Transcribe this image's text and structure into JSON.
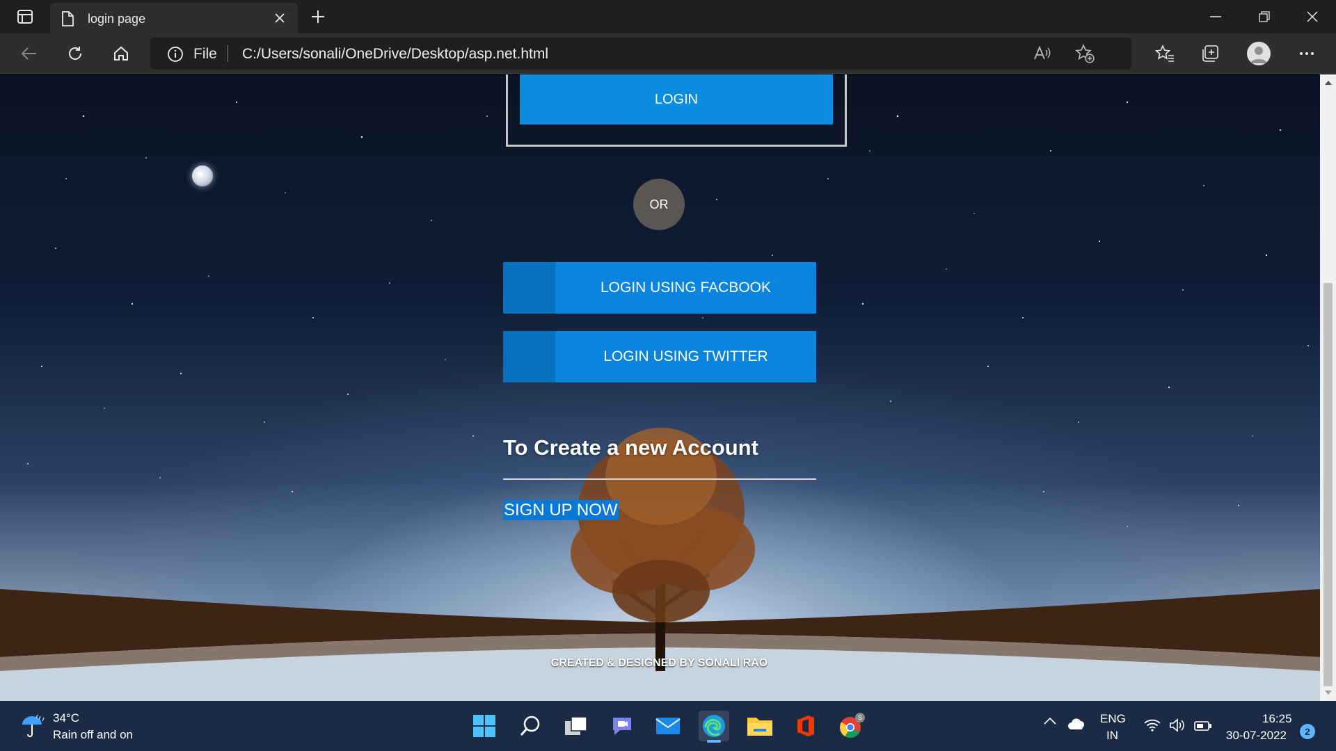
{
  "browser": {
    "tab_title": "login page",
    "address_scheme_label": "File",
    "address_url": "C:/Users/sonali/OneDrive/Desktop/asp.net.html"
  },
  "page": {
    "login_button": "LOGIN",
    "or_label": "OR",
    "facebook_button": "LOGIN USING FACBOOK",
    "twitter_button": "LOGIN USING TWITTER",
    "create_account_title": "To Create a new Account",
    "signup_link": "SIGN UP NOW",
    "credit": "CREATED & DESIGNED BY SONALI RAO"
  },
  "taskbar": {
    "weather_temp": "34°C",
    "weather_desc": "Rain off and on",
    "lang_line1": "ENG",
    "lang_line2": "IN",
    "time": "16:25",
    "date": "30-07-2022",
    "notifications": "2"
  },
  "colors": {
    "button_blue": "#0a84dd",
    "button_side": "#0672c0",
    "or_circle": "#5a5653",
    "signup_highlight": "#0a78d6"
  }
}
